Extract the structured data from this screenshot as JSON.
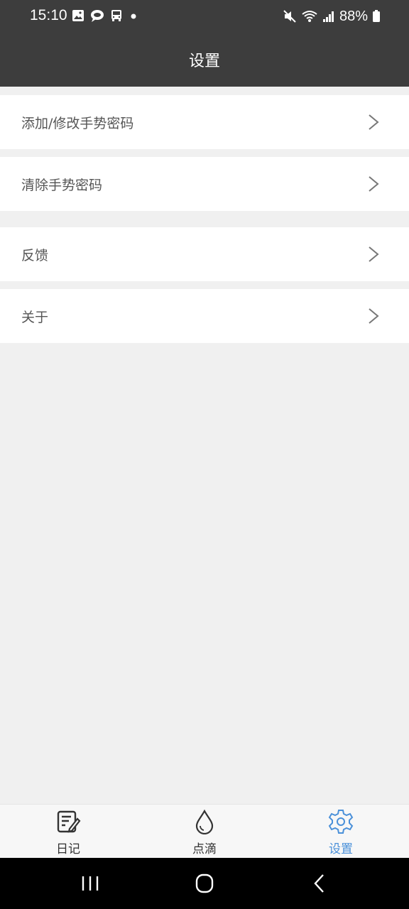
{
  "status_bar": {
    "time": "15:10",
    "battery": "88%",
    "icons": [
      "image-icon",
      "chat-bubble-icon",
      "bus-icon",
      "dot-icon",
      "mute-icon",
      "wifi-icon",
      "signal-icon",
      "battery-icon"
    ]
  },
  "header": {
    "title": "设置"
  },
  "menu": [
    {
      "label": "添加/修改手势密码"
    },
    {
      "label": "清除手势密码"
    },
    {
      "label": "反馈"
    },
    {
      "label": "关于"
    }
  ],
  "tabs": [
    {
      "label": "日记",
      "icon": "diary-icon"
    },
    {
      "label": "点滴",
      "icon": "drop-icon"
    },
    {
      "label": "设置",
      "icon": "gear-icon"
    }
  ],
  "colors": {
    "header_bg": "#3d3d3d",
    "active_tab": "#4a90d9"
  }
}
